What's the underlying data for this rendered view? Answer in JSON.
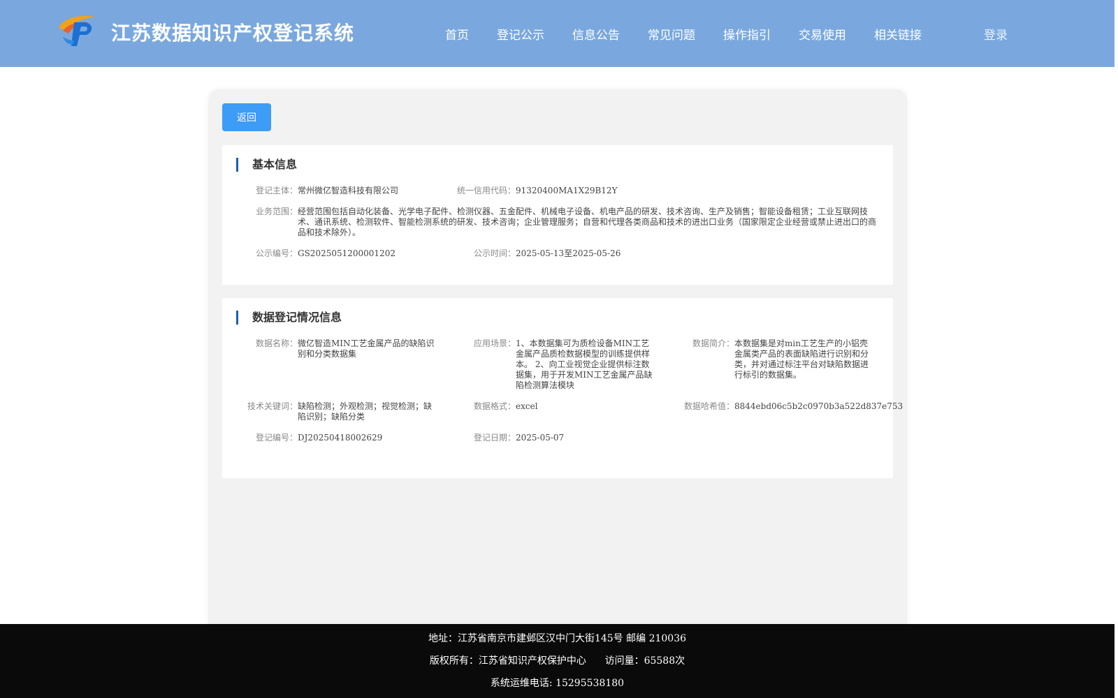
{
  "header": {
    "title": "江苏数据知识产权登记系统",
    "nav": [
      "首页",
      "登记公示",
      "信息公告",
      "常见问题",
      "操作指引",
      "交易使用",
      "相关链接"
    ],
    "login": "登录",
    "logo_icon": "ip-logo-icon"
  },
  "back_label": "返回",
  "basic": {
    "title": "基本信息",
    "subject_label": "登记主体：",
    "subject": "常州微亿智造科技有限公司",
    "credit_code_label": "统一信用代码：",
    "credit_code": "91320400MA1X29B12Y",
    "scope_label": "业务范围：",
    "scope": "经营范围包括自动化装备、光学电子配件、检测仪器、五金配件、机械电子设备、机电产品的研发、技术咨询、生产及销售；智能设备租赁；工业互联网技术、通讯系统、检测软件、智能检测系统的研发、技术咨询；企业管理服务；自营和代理各类商品和技术的进出口业务（国家限定企业经营或禁止进出口的商品和技术除外）。",
    "notice_no_label": "公示编号：",
    "notice_no": "GS2025051200001202",
    "notice_time_label": "公示时间：",
    "notice_time": "2025-05-13至2025-05-26"
  },
  "data": {
    "title": "数据登记情况信息",
    "name_label": "数据名称：",
    "name": "微亿智造MIN工艺金属产品的缺陷识别和分类数据集",
    "scene_label": "应用场景：",
    "scene": "1、本数据集可为质检设备MIN工艺金属产品质检数据模型的训练提供样本。 2、向工业视觉企业提供标注数据集，用于开发MIN工艺金属产品缺陷检测算法模块",
    "intro_label": "数据简介：",
    "intro": "本数据集是对min工艺生产的小铝壳金属类产品的表面缺陷进行识别和分类，并对通过标注平台对缺陷数据进行标引的数据集。",
    "keywords_label": "技术关键词：",
    "keywords": "缺陷检测；外观检测；视觉检测；缺陷识别；缺陷分类",
    "format_label": "数据格式：",
    "format": "excel",
    "hash_label": "数据哈希值：",
    "hash": "8844ebd06c5b2c0970b3a522d837e753",
    "reg_no_label": "登记编号：",
    "reg_no": "DJ20250418002629",
    "reg_date_label": "登记日期：",
    "reg_date": "2025-05-07"
  },
  "footer": {
    "address": "地址：江苏省南京市建邺区汉中门大街145号 邮编 210036",
    "copyright": "版权所有：江苏省知识产权保护中心      访问量：65588次",
    "phone": "系统运维电话: 15295538180"
  },
  "colors": {
    "header_bg": "#7aa8de",
    "accent_button": "#3d9cf5",
    "section_bar": "#1f5fa8",
    "footer_bg": "#0a0a0a"
  }
}
